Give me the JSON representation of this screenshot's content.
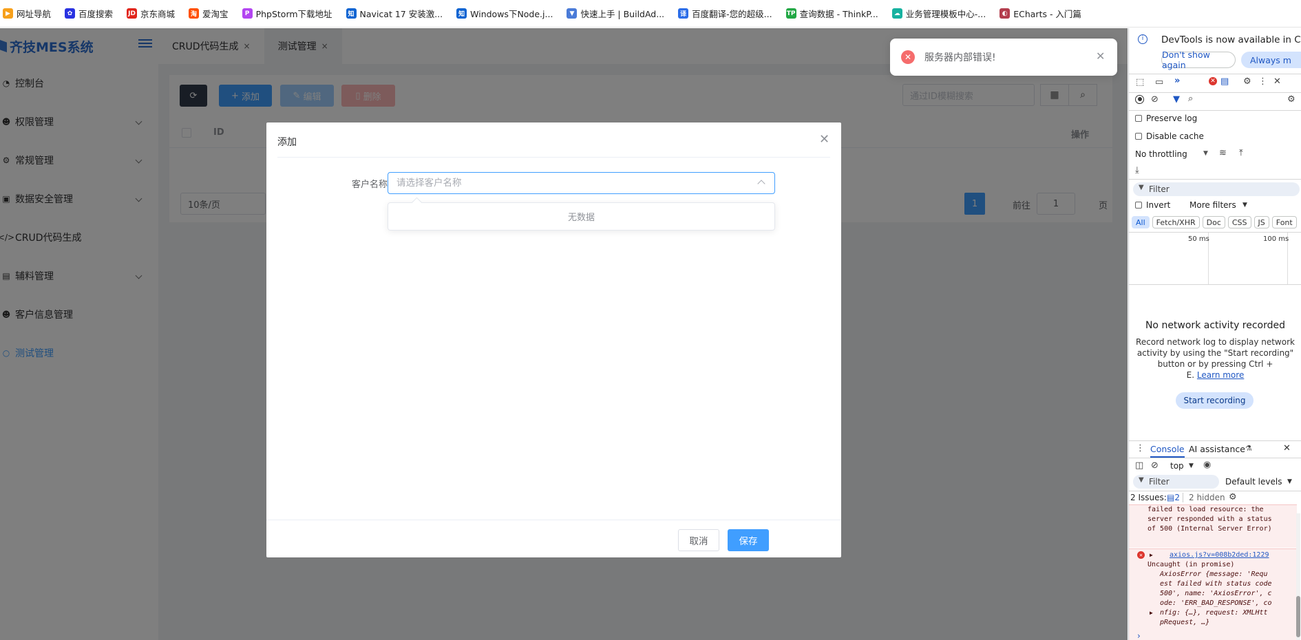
{
  "bookmarks": [
    {
      "label": "网址导航",
      "color": "#f7a01b",
      "glyph": "▶"
    },
    {
      "label": "百度搜索",
      "color": "#2932e1",
      "glyph": "✿"
    },
    {
      "label": "京东商城",
      "color": "#e1251b",
      "glyph": "JD"
    },
    {
      "label": "爱淘宝",
      "color": "#ff5000",
      "glyph": "淘"
    },
    {
      "label": "PhpStorm下载地址",
      "color": "#b345f1",
      "glyph": "P"
    },
    {
      "label": "Navicat 17 安装激...",
      "color": "#0f64d2",
      "glyph": "知"
    },
    {
      "label": "Windows下Node.j...",
      "color": "#0f64d2",
      "glyph": "知"
    },
    {
      "label": "快速上手 | BuildAd...",
      "color": "#4a7bd8",
      "glyph": "▼"
    },
    {
      "label": "百度翻译-您的超级...",
      "color": "#2b6de8",
      "glyph": "译"
    },
    {
      "label": "查询数据 - ThinkP...",
      "color": "#22a845",
      "glyph": "TP"
    },
    {
      "label": "业务管理模板中心-...",
      "color": "#17b2a0",
      "glyph": "☁"
    },
    {
      "label": "ECharts - 入门篇",
      "color": "#b33d4d",
      "glyph": "◐"
    }
  ],
  "sidebar": {
    "logo": "齐技MES系统",
    "items": [
      {
        "label": "控制台",
        "icon": "dashboard-icon",
        "glyph": "◔",
        "expandable": false,
        "active": false
      },
      {
        "label": "权限管理",
        "icon": "users-icon",
        "glyph": "☻",
        "expandable": true,
        "active": false
      },
      {
        "label": "常规管理",
        "icon": "settings-icon",
        "glyph": "⚙",
        "expandable": true,
        "active": false
      },
      {
        "label": "数据安全管理",
        "icon": "database-icon",
        "glyph": "▣",
        "expandable": true,
        "active": false
      },
      {
        "label": "CRUD代码生成",
        "icon": "code-icon",
        "glyph": "</>",
        "expandable": false,
        "active": false
      },
      {
        "label": "辅料管理",
        "icon": "box-icon",
        "glyph": "▤",
        "expandable": true,
        "active": false
      },
      {
        "label": "客户信息管理",
        "icon": "user-icon",
        "glyph": "☻",
        "expandable": false,
        "active": false
      },
      {
        "label": "测试管理",
        "icon": "circle-icon",
        "glyph": "○",
        "expandable": false,
        "active": true
      }
    ]
  },
  "tabs": [
    {
      "label": "CRUD代码生成",
      "active": false
    },
    {
      "label": "测试管理",
      "active": true
    }
  ],
  "toolbar": {
    "refresh_icon": "refresh-icon",
    "add_label": "添加",
    "edit_label": "编辑",
    "delete_label": "删除",
    "search_placeholder": "通过ID模糊搜索"
  },
  "table": {
    "columns": [
      "ID",
      "操作"
    ]
  },
  "pagination": {
    "page_size": "10条/页",
    "current_page": "1",
    "goto_label": "前往",
    "goto_value": "1",
    "page_suffix": "页"
  },
  "dialog": {
    "title": "添加",
    "field_label": "客户名称",
    "field_placeholder": "请选择客户名称",
    "dropdown_empty": "无数据",
    "cancel_label": "取消",
    "save_label": "保存"
  },
  "toast": {
    "message": "服务器内部错误!"
  },
  "devtools": {
    "notice": "DevTools is now available in Chi",
    "dont_show": "Don't show again",
    "always": "Always m",
    "preserve_log": "Preserve log",
    "disable_cache": "Disable cache",
    "throttling": "No throttling",
    "filter_placeholder": "Filter",
    "invert": "Invert",
    "more_filters": "More filters",
    "type_chips": [
      "All",
      "Fetch/XHR",
      "Doc",
      "CSS",
      "JS",
      "Font"
    ],
    "timeline_ticks": [
      "50 ms",
      "100 ms"
    ],
    "empty_title": "No network activity recorded",
    "empty_desc_1": "Record network log to display network",
    "empty_desc_2": "activity by using the \"Start recording\"",
    "empty_desc_3": "button or by pressing Ctrl +",
    "empty_desc_4": "E.",
    "learn_more": "Learn more",
    "start_recording": "Start recording",
    "console_tab": "Console",
    "ai_tab": "AI assistance",
    "context": "top",
    "console_filter": "Filter",
    "levels": "Default levels",
    "issues_label": "2 Issues:",
    "issues_count": "2",
    "hidden": "2 hidden",
    "log_lines_1": [
      "failed to load resource: the",
      "server responded with a status",
      "of 500 (Internal Server Error)"
    ],
    "link": "axios.js?v=008b2ded:1229",
    "uncaught": "Uncaught (in promise)",
    "error_lines": [
      "AxiosError {message: 'Requ",
      "est failed with status code",
      "500', name: 'AxiosError', c",
      "ode: 'ERR_BAD_RESPONSE', co",
      "nfig: {…}, request: XMLHtt",
      "pRequest, …}"
    ]
  }
}
